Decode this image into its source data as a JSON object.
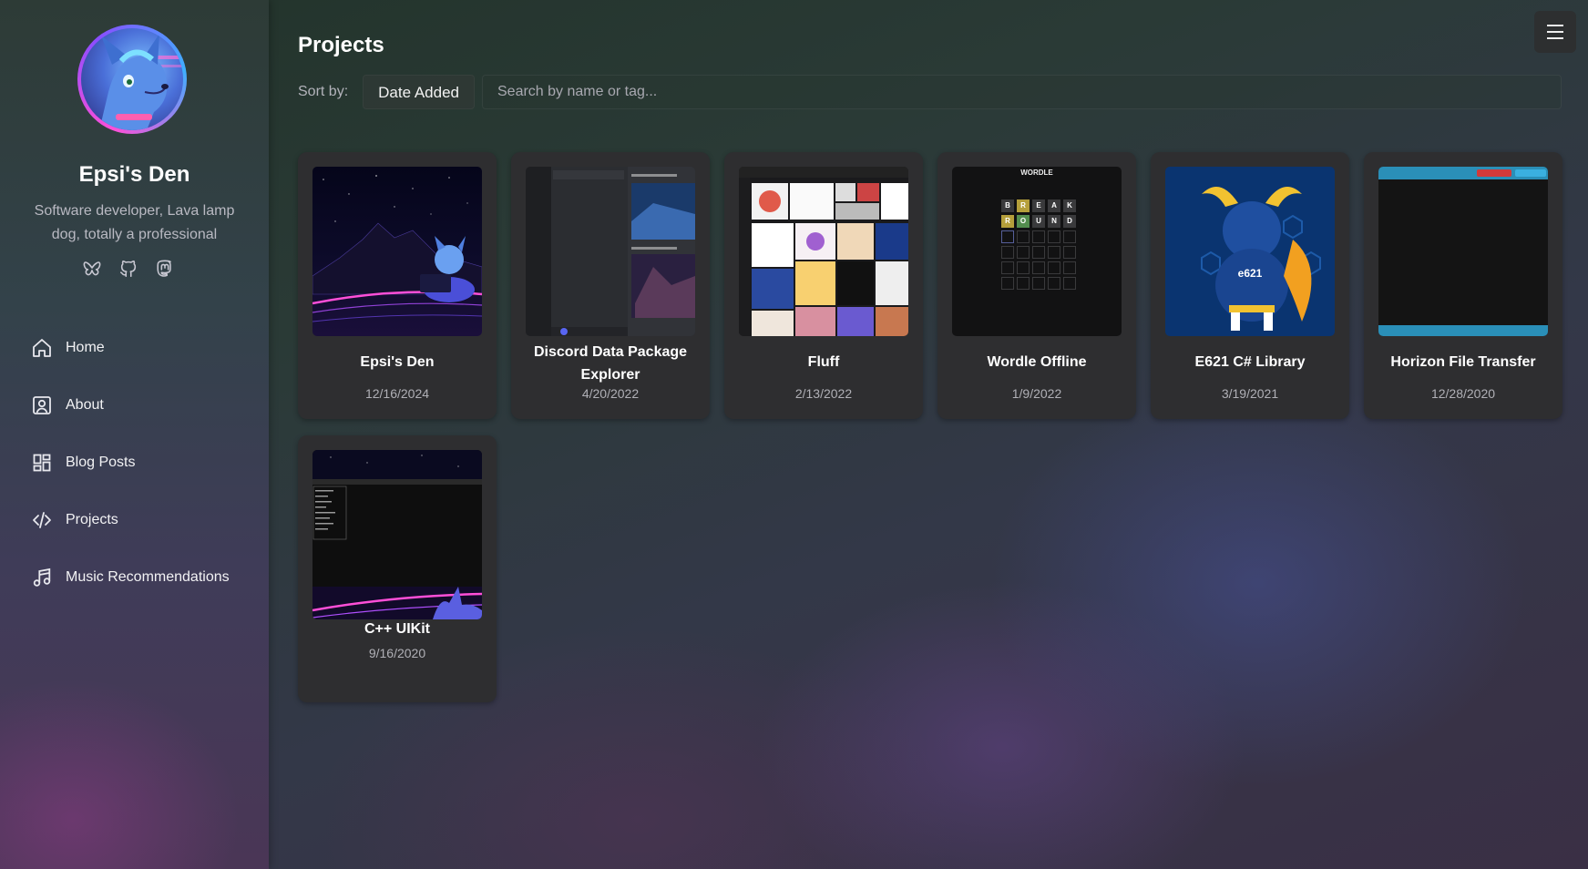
{
  "site": {
    "title": "Epsi's Den",
    "description": "Software developer, Lava lamp dog, totally a professional"
  },
  "socials": [
    {
      "icon": "butterfly-icon"
    },
    {
      "icon": "github-icon"
    },
    {
      "icon": "mastodon-icon"
    }
  ],
  "nav": [
    {
      "label": "Home",
      "icon": "home-icon"
    },
    {
      "label": "About",
      "icon": "user-portrait-icon"
    },
    {
      "label": "Blog Posts",
      "icon": "grid-icon"
    },
    {
      "label": "Projects",
      "icon": "code-icon"
    },
    {
      "label": "Music Recommendations",
      "icon": "music-note-icon"
    }
  ],
  "page": {
    "title": "Projects",
    "sort_label": "Sort by:",
    "sort_value": "Date Added",
    "search_placeholder": "Search by name or tag..."
  },
  "projects": [
    {
      "title": "Epsi's Den",
      "date": "12/16/2024"
    },
    {
      "title": "Discord Data Package Explorer",
      "date": "4/20/2022"
    },
    {
      "title": "Fluff",
      "date": "2/13/2022"
    },
    {
      "title": "Wordle Offline",
      "date": "1/9/2022"
    },
    {
      "title": "E621 C# Library",
      "date": "3/19/2021"
    },
    {
      "title": "Horizon File Transfer",
      "date": "12/28/2020"
    },
    {
      "title": "C++ UIKit",
      "date": "9/16/2020"
    }
  ],
  "thumb_text": {
    "wordle_header": "WORDLE",
    "wordle_row1": [
      "B",
      "R",
      "E",
      "A",
      "K"
    ],
    "wordle_row2": [
      "R",
      "O",
      "U",
      "N",
      "D"
    ],
    "e621_label": "e621"
  },
  "colors": {
    "accent": "#8a4dff",
    "card_bg": "#2e2e30",
    "neon_pink": "#ff4fd8"
  }
}
